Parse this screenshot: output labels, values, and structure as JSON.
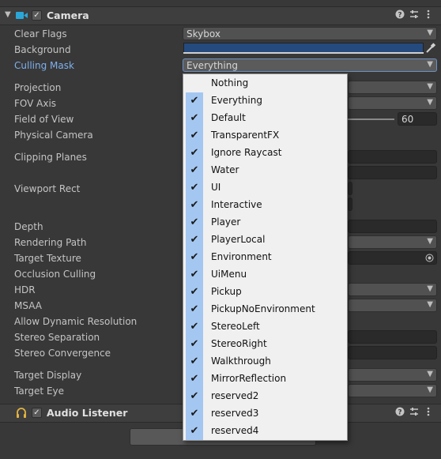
{
  "camera": {
    "title": "Camera",
    "enabled_check": "✓",
    "fields": {
      "clear_flags": {
        "label": "Clear Flags",
        "value": "Skybox"
      },
      "background": {
        "label": "Background",
        "color": "#254a7e"
      },
      "culling_mask": {
        "label": "Culling Mask",
        "value": "Everything"
      },
      "projection": {
        "label": "Projection"
      },
      "fov_axis": {
        "label": "FOV Axis"
      },
      "field_of_view": {
        "label": "Field of View",
        "value": "60"
      },
      "physical_camera": {
        "label": "Physical Camera"
      },
      "clipping_planes": {
        "label": "Clipping Planes"
      },
      "viewport_rect": {
        "label": "Viewport Rect"
      },
      "depth": {
        "label": "Depth"
      },
      "rendering_path": {
        "label": "Rendering Path"
      },
      "target_texture": {
        "label": "Target Texture"
      },
      "occlusion_culling": {
        "label": "Occlusion Culling"
      },
      "hdr": {
        "label": "HDR"
      },
      "msaa": {
        "label": "MSAA"
      },
      "allow_dynamic_resolution": {
        "label": "Allow Dynamic Resolution"
      },
      "stereo_separation": {
        "label": "Stereo Separation"
      },
      "stereo_convergence": {
        "label": "Stereo Convergence"
      },
      "target_display": {
        "label": "Target Display"
      },
      "target_eye": {
        "label": "Target Eye"
      }
    }
  },
  "audio_listener": {
    "title": "Audio Listener",
    "enabled_check": "✓"
  },
  "culling_menu": {
    "items": [
      {
        "label": "Nothing",
        "checked": false
      },
      {
        "label": "Everything",
        "checked": true
      },
      {
        "label": "Default",
        "checked": true
      },
      {
        "label": "TransparentFX",
        "checked": true
      },
      {
        "label": "Ignore Raycast",
        "checked": true
      },
      {
        "label": "Water",
        "checked": true
      },
      {
        "label": "UI",
        "checked": true
      },
      {
        "label": "Interactive",
        "checked": true
      },
      {
        "label": "Player",
        "checked": true
      },
      {
        "label": "PlayerLocal",
        "checked": true
      },
      {
        "label": "Environment",
        "checked": true
      },
      {
        "label": "UiMenu",
        "checked": true
      },
      {
        "label": "Pickup",
        "checked": true
      },
      {
        "label": "PickupNoEnvironment",
        "checked": true
      },
      {
        "label": "StereoLeft",
        "checked": true
      },
      {
        "label": "StereoRight",
        "checked": true
      },
      {
        "label": "Walkthrough",
        "checked": true
      },
      {
        "label": "MirrorReflection",
        "checked": true
      },
      {
        "label": "reserved2",
        "checked": true
      },
      {
        "label": "reserved3",
        "checked": true
      },
      {
        "label": "reserved4",
        "checked": true
      }
    ]
  },
  "icons": {
    "foldout": "collapse-arrow-icon",
    "camera": "camera-icon",
    "audio": "headphones-icon",
    "help": "help-icon",
    "presets": "presets-icon",
    "menu": "kebab-menu-icon",
    "picker": "eyedropper-icon",
    "object_picker": "object-picker-icon"
  },
  "colors": {
    "accent_label": "#7eb0ee",
    "menu_check_bg": "#a4c7f1"
  }
}
